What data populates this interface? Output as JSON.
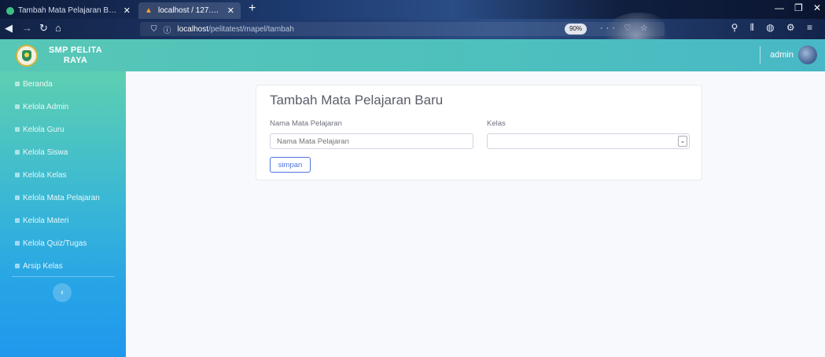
{
  "browser": {
    "tabs": [
      {
        "label": "Tambah Mata Pelajaran Baru",
        "close": "✕"
      },
      {
        "label": "localhost / 127.0.0.1 / pelita / a",
        "close": "✕"
      }
    ],
    "new_tab": "+",
    "url_host": "localhost",
    "url_path": "/pelitatest/mapel/tambah",
    "zoom": "90%",
    "page_actions": "··· ♡ ☆"
  },
  "header": {
    "brand_line1": "SMP PELITA",
    "brand_line2": "RAYA",
    "user_name": "admin"
  },
  "sidebar": {
    "items": [
      {
        "label": "Beranda"
      },
      {
        "label": "Kelola Admin"
      },
      {
        "label": "Kelola Guru"
      },
      {
        "label": "Kelola Siswa"
      },
      {
        "label": "Kelola Kelas"
      },
      {
        "label": "Kelola Mata Pelajaran"
      },
      {
        "label": "Kelola Materi"
      },
      {
        "label": "Kelola Quiz/Tugas"
      },
      {
        "label": "Arsip Kelas"
      }
    ],
    "toggle_glyph": "‹"
  },
  "form": {
    "title": "Tambah Mata Pelajaran Baru",
    "subject_label": "Nama Mata Pelajaran",
    "subject_placeholder": "Nama Mata Pelajaran",
    "class_label": "Kelas",
    "class_value": "",
    "save_label": "simpan"
  }
}
